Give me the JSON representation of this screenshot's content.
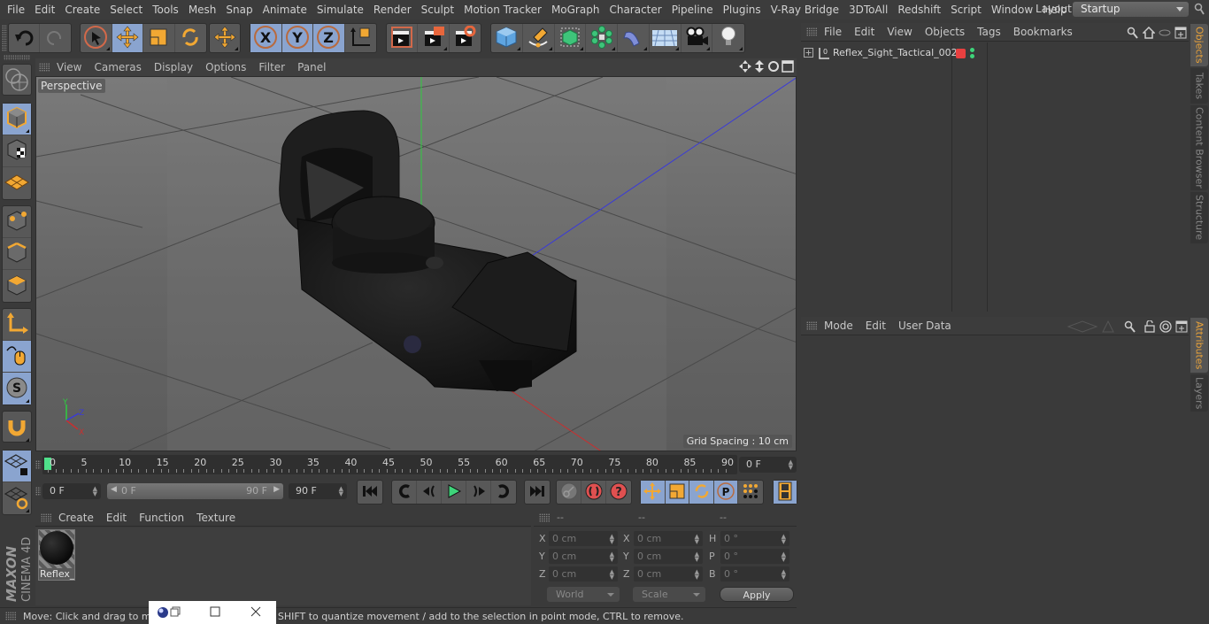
{
  "menubar": {
    "items": [
      "File",
      "Edit",
      "Create",
      "Select",
      "Tools",
      "Mesh",
      "Snap",
      "Animate",
      "Simulate",
      "Render",
      "Sculpt",
      "Motion Tracker",
      "MoGraph",
      "Character",
      "Pipeline",
      "Plugins",
      "V-Ray Bridge",
      "3DToAll",
      "Redshift",
      "Script",
      "Window",
      "Help"
    ],
    "layout_label": "Layout:",
    "layout_value": "Startup"
  },
  "toolbar": {
    "buttons": [
      "undo",
      "redo",
      "live-selection",
      "move",
      "scale",
      "rotate",
      "transform",
      "x-axis-lock",
      "y-axis-lock",
      "z-axis-lock",
      "coordinate-system",
      "render-view",
      "render-to-picture-viewer",
      "render-settings",
      "cube",
      "pen",
      "subdivision-surface",
      "cloner",
      "bend-deformer",
      "floor",
      "camera",
      "light"
    ],
    "axis_labels": [
      "X",
      "Y",
      "Z"
    ]
  },
  "viewport": {
    "menu": [
      "View",
      "Cameras",
      "Display",
      "Options",
      "Filter",
      "Panel"
    ],
    "camera_label": "Perspective",
    "grid_spacing": "Grid Spacing : 10 cm",
    "axis_labels": {
      "x": "X",
      "y": "Y",
      "z": "Z"
    }
  },
  "timeline": {
    "ticks": [
      "0",
      "5",
      "10",
      "15",
      "20",
      "25",
      "30",
      "35",
      "40",
      "45",
      "50",
      "55",
      "60",
      "65",
      "70",
      "75",
      "80",
      "85",
      "90"
    ],
    "current_frame_field": "0 F",
    "start_field": "0 F",
    "range_start": "0 F",
    "range_end": "90 F",
    "end_field": "90 F",
    "accent": "#4fe08a"
  },
  "material_manager": {
    "menu": [
      "Create",
      "Edit",
      "Function",
      "Texture"
    ],
    "materials": [
      {
        "name": "Reflex_S"
      }
    ]
  },
  "coordinates": {
    "headers": [
      "--",
      "--",
      "--"
    ],
    "rows": [
      {
        "l1": "X",
        "v1": "0 cm",
        "l2": "X",
        "v2": "0 cm",
        "l3": "H",
        "v3": "0 °"
      },
      {
        "l1": "Y",
        "v1": "0 cm",
        "l2": "Y",
        "v2": "0 cm",
        "l3": "P",
        "v3": "0 °"
      },
      {
        "l1": "Z",
        "v1": "0 cm",
        "l2": "Z",
        "v2": "0 cm",
        "l3": "B",
        "v3": "0 °"
      }
    ],
    "space_select": "World",
    "mode_select": "Scale",
    "apply_label": "Apply"
  },
  "status": {
    "text": "Move: Click and drag to move elements. Hold down SHIFT to quantize movement / add to the selection in point mode, CTRL to remove."
  },
  "object_manager": {
    "menu": [
      "File",
      "Edit",
      "View",
      "Objects",
      "Tags",
      "Bookmarks"
    ],
    "objects": [
      {
        "name": "Reflex_Sight_Tactical_002",
        "layer_color": "#e84040"
      }
    ]
  },
  "attribute_manager": {
    "menu": [
      "Mode",
      "Edit",
      "User Data"
    ]
  },
  "side_tabs": {
    "top": [
      "Objects",
      "Takes",
      "Content Browser",
      "Structure"
    ],
    "bottom": [
      "Attributes",
      "Layers"
    ],
    "active_color": "#e8a23a"
  },
  "brand": {
    "line1": "MAXON",
    "line2": "CINEMA 4D"
  }
}
